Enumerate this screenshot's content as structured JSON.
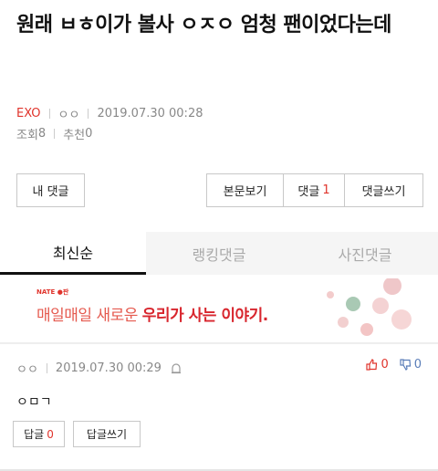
{
  "article": {
    "title": "원래 ㅂㅎ이가 볼사 ㅇㅈㅇ 엄청 팬이었다는데",
    "category": "EXO",
    "author": "ㅇㅇ",
    "date": "2019.07.30 00:28",
    "views_label": "조회",
    "views": "8",
    "recommend_label": "추천",
    "recommend": "0"
  },
  "buttons": {
    "my_comments": "내 댓글",
    "view_body": "본문보기",
    "comments": "댓글",
    "comments_count": "1",
    "write_comment": "댓글쓰기"
  },
  "tabs": [
    {
      "label": "최신순",
      "active": true
    },
    {
      "label": "랭킹댓글",
      "active": false
    },
    {
      "label": "사진댓글",
      "active": false
    }
  ],
  "banner": {
    "brand": "NATE ●판",
    "text_plain": "매일매일 새로운 ",
    "text_bold": "우리가 사는 이야기."
  },
  "comment": {
    "author": "ㅇㅇ",
    "date": "2019.07.30 00:29",
    "likes": "0",
    "dislikes": "0",
    "body": "ㅇㅁㄱ",
    "reply_label": "답글",
    "reply_count": "0",
    "write_reply": "답글쓰기"
  },
  "colors": {
    "accent": "#e0342c",
    "dislike": "#5a7db8"
  }
}
